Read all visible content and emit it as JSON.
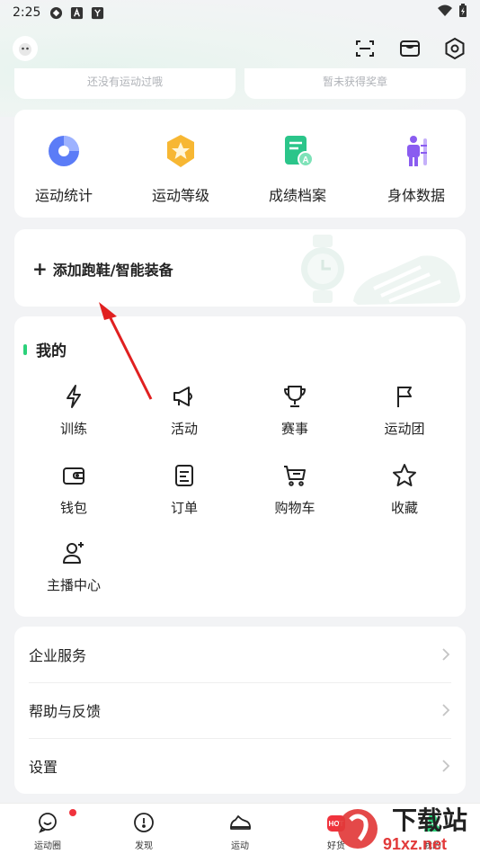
{
  "status_bar": {
    "time": "2:25"
  },
  "badges": {
    "left_text": "还没有运动过哦",
    "right_text": "暂未获得奖章"
  },
  "quick_actions": [
    {
      "label": "运动统计",
      "icon": "pie-chart-icon"
    },
    {
      "label": "运动等级",
      "icon": "level-medal-icon"
    },
    {
      "label": "成绩档案",
      "icon": "record-file-icon"
    },
    {
      "label": "身体数据",
      "icon": "body-data-icon"
    }
  ],
  "equipment": {
    "label": "添加跑鞋/智能装备",
    "plus": "+"
  },
  "mine": {
    "title": "我的",
    "items": [
      {
        "label": "训练",
        "icon": "lightning-icon"
      },
      {
        "label": "活动",
        "icon": "megaphone-icon"
      },
      {
        "label": "赛事",
        "icon": "trophy-icon"
      },
      {
        "label": "运动团",
        "icon": "flag-icon"
      },
      {
        "label": "钱包",
        "icon": "wallet-icon"
      },
      {
        "label": "订单",
        "icon": "order-icon"
      },
      {
        "label": "购物车",
        "icon": "cart-icon"
      },
      {
        "label": "收藏",
        "icon": "star-icon"
      },
      {
        "label": "主播中心",
        "icon": "streamer-icon"
      }
    ]
  },
  "menu": [
    {
      "label": "企业服务"
    },
    {
      "label": "帮助与反馈"
    },
    {
      "label": "设置"
    }
  ],
  "tabs": [
    {
      "label": "运动圈",
      "icon": "chat-bubble-icon"
    },
    {
      "label": "发现",
      "icon": "compass-icon"
    },
    {
      "label": "运动",
      "icon": "sneaker-icon"
    },
    {
      "label": "好货",
      "icon": "goods-icon",
      "badge": "HOT"
    },
    {
      "label": "我的",
      "icon": "profile-icon"
    }
  ],
  "watermark": {
    "text": "下载站",
    "domain": "91xz.net"
  },
  "colors": {
    "accent_green": "#2bd17a",
    "annotation_red": "#e02020"
  }
}
